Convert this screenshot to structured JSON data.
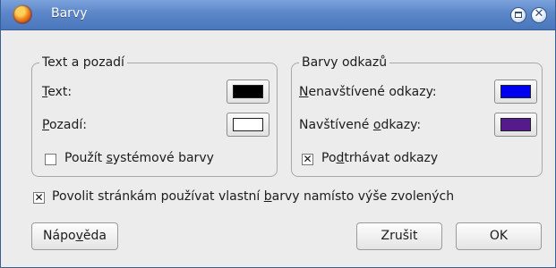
{
  "window": {
    "title": "Barvy",
    "app_icon": "firefox-icon",
    "controls": {
      "maximize_icon": "maximize-icon",
      "close_icon": "close-icon",
      "close_glyph": "✕"
    }
  },
  "text_group": {
    "legend": "Text a pozadí",
    "text_label": {
      "mnemonic": "T",
      "rest": "ext:"
    },
    "text_color": "#000000",
    "background_label": {
      "mnemonic": "P",
      "rest": "ozadí:"
    },
    "background_color": "#ffffff",
    "system_colors": {
      "before": "Použít ",
      "mnemonic": "s",
      "after": "ystémové barvy",
      "checked": false
    }
  },
  "links_group": {
    "legend": "Barvy odkazů",
    "unvisited_label": {
      "mnemonic": "N",
      "rest": "enavštívené odkazy:"
    },
    "unvisited_color": "#0000ee",
    "visited_label": {
      "before": "Navštívené ",
      "mnemonic": "o",
      "after": "dkazy:"
    },
    "visited_color": "#551a8b",
    "underline_links": {
      "before": "Po",
      "mnemonic": "d",
      "after": "trhávat odkazy",
      "checked": true
    }
  },
  "allow_page_colors": {
    "before": "Povolit stránkám používat vlastní ",
    "mnemonic": "b",
    "after": "arvy namísto výše zvolených",
    "checked": true
  },
  "buttons": {
    "help": {
      "before": "Nápo",
      "mnemonic": "v",
      "after": "ěda"
    },
    "cancel": "Zrušit",
    "ok": "OK"
  },
  "check_mark": "✕"
}
